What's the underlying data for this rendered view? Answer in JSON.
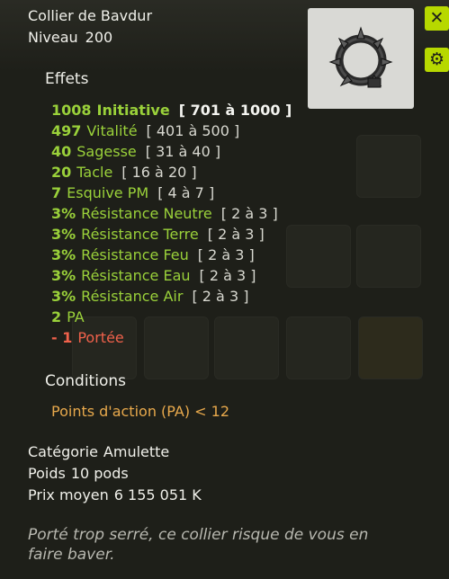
{
  "item": {
    "name": "Collier de Bavdur",
    "level_label": "Niveau",
    "level_value": "200",
    "image_icon": "spiked-collar-icon"
  },
  "buttons": {
    "close_icon": "close-icon",
    "settings_icon": "gear-icon"
  },
  "effects_title": "Effets",
  "effects": [
    {
      "value": "1008",
      "label": "Initiative",
      "range": "[ 701 à 1000 ]",
      "color": "green"
    },
    {
      "value": "497",
      "label": "Vitalité",
      "range": "[ 401 à 500 ]",
      "color": "green"
    },
    {
      "value": "40",
      "label": "Sagesse",
      "range": "[ 31 à 40 ]",
      "color": "green"
    },
    {
      "value": "20",
      "label": "Tacle",
      "range": "[ 16 à 20 ]",
      "color": "green"
    },
    {
      "value": "7",
      "label": "Esquive PM",
      "range": "[ 4 à 7 ]",
      "color": "green"
    },
    {
      "value": "3%",
      "label": "Résistance Neutre",
      "range": "[ 2 à 3 ]",
      "color": "green"
    },
    {
      "value": "3%",
      "label": "Résistance Terre",
      "range": "[ 2 à 3 ]",
      "color": "green"
    },
    {
      "value": "3%",
      "label": "Résistance Feu",
      "range": "[ 2 à 3 ]",
      "color": "green"
    },
    {
      "value": "3%",
      "label": "Résistance Eau",
      "range": "[ 2 à 3 ]",
      "color": "green"
    },
    {
      "value": "3%",
      "label": "Résistance Air",
      "range": "[ 2 à 3 ]",
      "color": "green"
    },
    {
      "value": "2",
      "label": "PA",
      "range": "",
      "color": "green"
    },
    {
      "value": "- 1",
      "label": "Portée",
      "range": "",
      "color": "red"
    }
  ],
  "conditions_title": "Conditions",
  "conditions": [
    "Points d'action (PA) < 12"
  ],
  "meta": {
    "category_label": "Catégorie",
    "category_value": "Amulette",
    "weight_label": "Poids",
    "weight_value": "10 pods",
    "price_label": "Prix moyen",
    "price_value": "6 155 051 K"
  },
  "description": "Porté trop serré, ce collier risque de vous en faire baver.",
  "colors": {
    "background": "#1e1f19",
    "effect_green": "#9ad13a",
    "effect_red": "#f0614b",
    "condition": "#e8a94c",
    "accent_button": "#b7d800",
    "description": "#b8b8b0"
  }
}
